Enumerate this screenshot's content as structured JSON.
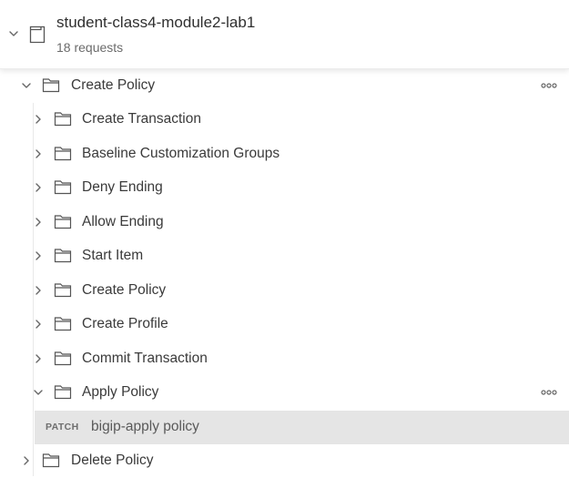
{
  "collection": {
    "title": "student-class4-module2-lab1",
    "subtitle": "18 requests"
  },
  "tree": {
    "root_folder": {
      "label": "Create Policy",
      "expanded": true,
      "more_label": "ooo"
    },
    "subfolders": [
      {
        "label": "Create Transaction",
        "expanded": false
      },
      {
        "label": "Baseline Customization Groups",
        "expanded": false
      },
      {
        "label": "Deny Ending",
        "expanded": false
      },
      {
        "label": "Allow Ending",
        "expanded": false
      },
      {
        "label": "Start Item",
        "expanded": false
      },
      {
        "label": "Create Policy",
        "expanded": false
      },
      {
        "label": "Create Profile",
        "expanded": false
      },
      {
        "label": "Commit Transaction",
        "expanded": false
      },
      {
        "label": "Apply Policy",
        "expanded": true,
        "more_label": "ooo"
      }
    ],
    "request": {
      "method": "PATCH",
      "name": "bigip-apply policy",
      "selected": true
    },
    "next_folder": {
      "label": "Delete Policy",
      "expanded": false
    }
  },
  "colors": {
    "selected_row_bg": "#e5e5e5",
    "text": "#3a3a3a",
    "muted": "#6b6b6b"
  },
  "icons": {
    "chevron_collapsed": "chevron-right-icon",
    "chevron_expanded": "chevron-down-icon",
    "folder": "folder-icon",
    "collection": "collection-icon",
    "more": "more-options-icon"
  }
}
